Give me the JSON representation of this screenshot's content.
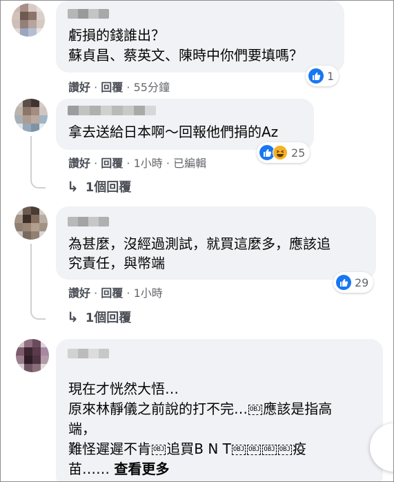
{
  "comments": [
    {
      "lines": [
        "虧損的錢誰出？",
        "蘇貞昌、蔡英文、陳時中你們要填嗎？"
      ],
      "like_label": "讚好",
      "reply_label": "回覆",
      "time": "55分鐘",
      "edited": "",
      "reaction_count": "1",
      "reactions": [
        "like-icon"
      ],
      "replies_label": ""
    },
    {
      "lines": [
        "拿去送給日本啊～回報他們捐的Az"
      ],
      "like_label": "讚好",
      "reply_label": "回覆",
      "time": "1小時",
      "edited": "已編輯",
      "reaction_count": "25",
      "reactions": [
        "like-icon",
        "haha-icon"
      ],
      "replies_label": "1個回覆"
    },
    {
      "lines": [
        "為甚麼，沒經過測試，就買這麼多，應該追",
        "究責任，與幣端"
      ],
      "like_label": "讚好",
      "reply_label": "回覆",
      "time": "1小時",
      "edited": "",
      "reaction_count": "29",
      "reactions": [
        "like-icon"
      ],
      "replies_label": "1個回覆"
    },
    {
      "line1": "現在才恍然大悟…",
      "line2a": "原來林靜儀之前說的打不完…",
      "line2b": "應該是指高",
      "line3": "端，",
      "line4a": "難怪遲遲不肯",
      "line4b": "追買B N T",
      "line4c": "疫",
      "line5a": "苗……",
      "see_more": "查看更多",
      "obj": "OBJ"
    }
  ],
  "separator": "·",
  "colors": {
    "bubble": "#f0f2f5",
    "like": "#1877f2",
    "haha": "#f7b125",
    "meta": "#65676b"
  }
}
